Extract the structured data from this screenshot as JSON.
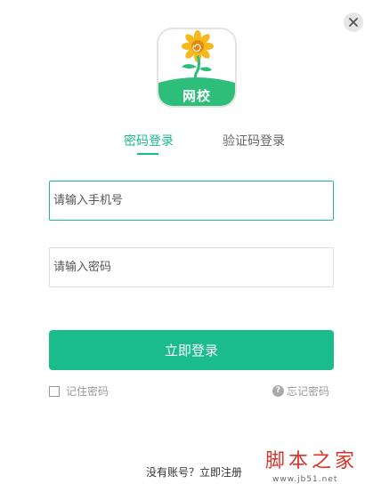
{
  "logo": {
    "label": "网校"
  },
  "tabs": [
    {
      "label": "密码登录",
      "active": true
    },
    {
      "label": "验证码登录",
      "active": false
    }
  ],
  "phone_field": {
    "placeholder": "请输入手机号",
    "value": ""
  },
  "password_field": {
    "placeholder": "请输入密码",
    "value": ""
  },
  "login_button": {
    "label": "立即登录"
  },
  "remember": {
    "label": "记住密码",
    "checked": false
  },
  "forgot": {
    "label": "忘记密码"
  },
  "register": {
    "label": "没有账号？立即注册"
  },
  "watermark": {
    "main": "脚本之家",
    "sub": "www.jb51.net"
  },
  "colors": {
    "accent": "#1abc8c",
    "watermark": "#d7342a"
  },
  "icons": [
    "close-icon",
    "sunflower-logo-icon",
    "help-icon"
  ]
}
